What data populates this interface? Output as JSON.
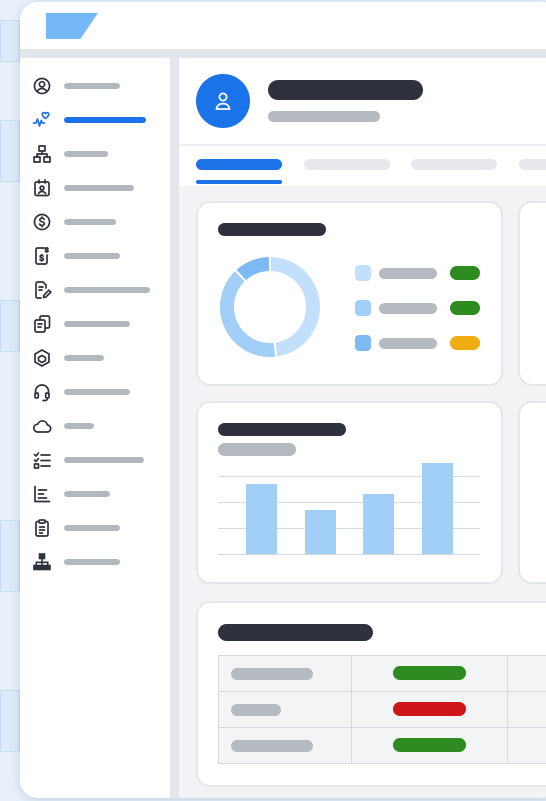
{
  "colors": {
    "accent": "#1e72e8",
    "logo": "#76b8f7",
    "title_placeholder": "#2d323c",
    "text_placeholder": "#b5bac1",
    "status_green": "#2e8b1f",
    "status_red": "#d0151a",
    "status_amber": "#f0ad12",
    "chart_blue": "#a2cff8"
  },
  "sidebar": {
    "items": [
      {
        "icon": "user-circle-icon",
        "active": false
      },
      {
        "icon": "heart-pulse-icon",
        "active": true
      },
      {
        "icon": "sitemap-icon",
        "active": false
      },
      {
        "icon": "calendar-user-icon",
        "active": false
      },
      {
        "icon": "dollar-circle-icon",
        "active": false
      },
      {
        "icon": "money-document-icon",
        "active": false
      },
      {
        "icon": "document-edit-icon",
        "active": false
      },
      {
        "icon": "copy-documents-icon",
        "active": false
      },
      {
        "icon": "cube-icon",
        "active": false
      },
      {
        "icon": "headset-icon",
        "active": false
      },
      {
        "icon": "cloud-icon",
        "active": false
      },
      {
        "icon": "checklist-icon",
        "active": false
      },
      {
        "icon": "bar-list-icon",
        "active": false
      },
      {
        "icon": "clipboard-icon",
        "active": false
      },
      {
        "icon": "network-icon",
        "active": false
      }
    ]
  },
  "header": {
    "avatar_icon": "person-icon"
  },
  "tabs": [
    {
      "active": true
    },
    {
      "active": false
    },
    {
      "active": false
    },
    {
      "active": false
    }
  ],
  "donut_card": {
    "chart_data": {
      "type": "pie",
      "slices": [
        {
          "value": 48,
          "color": "#c2e0fb"
        },
        {
          "value": 40,
          "color": "#a2cff8"
        },
        {
          "value": 12,
          "color": "#7dbaf3"
        }
      ]
    },
    "legend": [
      {
        "swatch": "#c2e0fb",
        "status": "green"
      },
      {
        "swatch": "#a2cff8",
        "status": "green"
      },
      {
        "swatch": "#7dbaf3",
        "status": "amber"
      }
    ]
  },
  "bar_card": {
    "chart_data": {
      "type": "bar",
      "values": [
        70,
        44,
        60,
        91
      ],
      "ylim": [
        0,
        100
      ],
      "grid": true
    }
  },
  "table_card": {
    "rows": [
      {
        "status": "green"
      },
      {
        "status": "red"
      },
      {
        "status": "green"
      }
    ]
  }
}
